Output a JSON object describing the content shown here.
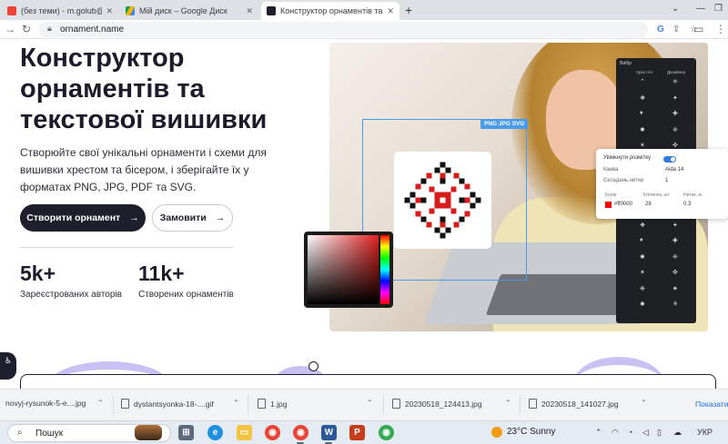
{
  "browser": {
    "tabs": [
      {
        "label": "(без теми) - m.golub@ippo.edu.ua"
      },
      {
        "label": "Мій диск – Google Диск"
      },
      {
        "label": "Конструктор орнаментів та текстової вишивки"
      }
    ],
    "url": "ornament.name"
  },
  "hero": {
    "title": "Конструктор орнаментів та текстової вишивки",
    "subtitle": "Створюйте свої унікальні орнаменти і схеми для вишивки хрестом та бісером, і зберігайте їх у форматах PNG, JPG, PDF та SVG.",
    "primary_button": "Створити орнамент",
    "secondary_button": "Замовити",
    "stats": [
      {
        "value": "5k+",
        "label": "Зареєстрованих авторів"
      },
      {
        "value": "11k+",
        "label": "Створених орнаментів"
      }
    ]
  },
  "illustration": {
    "formats_badge": "PNG  JPG  SVG",
    "palette": {
      "title": "Вибір",
      "col1": "Хрест./гл",
      "col2": "Дизайнер",
      "icons": [
        "⌃",
        "✳",
        "❖",
        "✦",
        "♦",
        "✚",
        "✸",
        "❈",
        "✶",
        "✜",
        "❉",
        "✷",
        "✹",
        "⚘",
        "✺",
        "❋"
      ]
    },
    "settings": {
      "toggle_label": "Увімкнути розмітку",
      "canvas_label": "Канва",
      "canvas_value": "Aida 14",
      "threads_label": "Складань нитки",
      "threads_value": "1",
      "color_header": "Колір",
      "stitch_header": "Клітинок, шт",
      "length_header": "Нитки, м",
      "color_value": "#ff0000",
      "stitch_value": "28",
      "length_value": "0.3"
    }
  },
  "downloads": {
    "items": [
      "novyj-rysunok-5-e....jpg",
      "dystantsyonka-18-....gif",
      "1.jpg",
      "20230518_124413.jpg",
      "20230518_141027.jpg"
    ],
    "show_all": "Показати"
  },
  "taskbar": {
    "search_placeholder": "Пошук",
    "weather": "23°C  Sunny",
    "lang": "УКР"
  },
  "colors": {
    "brand_dark": "#1e1e2c",
    "accent_blue": "#4a9be8",
    "decor_lilac": "#c9c1f2"
  }
}
